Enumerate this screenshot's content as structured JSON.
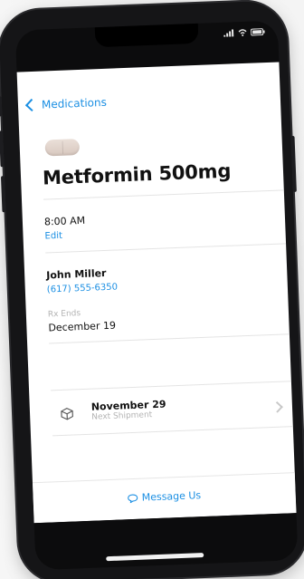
{
  "nav": {
    "back_label": "Medications"
  },
  "medication": {
    "name": "Metformin 500mg",
    "pill_color": "#e3d6cf"
  },
  "schedule": {
    "time": "8:00 AM",
    "edit_label": "Edit"
  },
  "prescriber": {
    "name": "John Miller",
    "phone": "(617) 555-6350",
    "rx_ends_label": "Rx Ends",
    "rx_ends_date": "December 19"
  },
  "shipment": {
    "date": "November 29",
    "label": "Next Shipment"
  },
  "footer": {
    "message_label": "Message Us"
  },
  "colors": {
    "accent": "#1b8fe3",
    "phone_body": "#151517"
  },
  "icons": {
    "back": "chevron-left-icon",
    "package": "box-icon",
    "detail": "chevron-right-icon",
    "message": "chat-bubble-icon",
    "signal": "signal-icon",
    "wifi": "wifi-icon",
    "battery": "battery-icon"
  }
}
